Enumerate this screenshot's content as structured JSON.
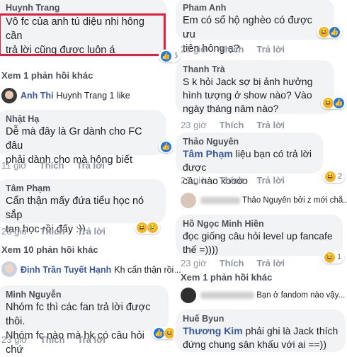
{
  "left": [
    {
      "name": "Huynh Trang",
      "lines": [
        "Vô fc của anh tú diệu nhi hông cần",
        "trả lời cũng được luôn á"
      ]
    },
    {
      "replies": "Xem 1 phản hồi khác"
    },
    {
      "sub_name": "Anh Thi",
      "sub_text": "Huynh Trang 1 like"
    },
    {
      "name": "Nhật Hạ",
      "lines": [
        "Dễ mà đây là Gr dành cho FC đâu",
        "phải dành cho mà hông biết"
      ],
      "time": "11 giờ",
      "like": "Thích",
      "reply": "Trả lời"
    },
    {
      "name": "Tâm Phạm",
      "lines": [
        "Cẩn thận mấy đứa tiểu học nó sắp",
        "tan học rồi đấy :))"
      ],
      "time": "23 giờ",
      "like": "Thích",
      "reply": "Trả lời"
    },
    {
      "replies": "Xem 10 phản hồi khác"
    },
    {
      "sub_name": "Đinh Trần Tuyết Hạnh",
      "sub_text": "Kh cẩn thận rồi..."
    },
    {
      "name": "Minh Nguyễn",
      "lines": [
        "Nhóm fc thì các fan trả lời được thôi.",
        "Nhóm fc nào mà hk có câu hỏi chứ"
      ],
      "time": "23 giờ",
      "like": "Thích",
      "reply": "Trả lời"
    }
  ],
  "right": [
    {
      "name": "Pham Anh",
      "lines": [
        "Em có sổ hộ nghèo có được ưu",
        "tiên hông ạ?"
      ],
      "time": "23 giờ",
      "like": "Thích",
      "reply": "Trả lời"
    },
    {
      "name": "Thanh Trà",
      "lines": [
        "S k hỏi Jack sợ bị ảnh hưởng",
        "hình tượng ở show nào?  Vào",
        "ngày tháng năm nào?"
      ],
      "time": "23 giờ",
      "like": "Thích",
      "reply": "Trả lời"
    },
    {
      "name": "Thảo Nguyên",
      "tag": "Tâm Phạm",
      "lines": [
        "liệu bạn có trả lời được",
        "câu nào koooo"
      ],
      "time": "23 giờ",
      "like": "Thích",
      "reply": "Trả lời"
    },
    {
      "sub_text": "Thảo Nguyên bởi z mới chắ..."
    },
    {
      "name": "Hồ Ngọc Minh Hiền",
      "lines": [
        "đọc giống câu hỏi level up fancafe",
        "thế =))))"
      ],
      "time": "23 giờ",
      "like": "Thích",
      "reply": "Trả lời"
    },
    {
      "replies": "Xem 1 phản hồi khác"
    },
    {
      "sub_text": "Bạn ở fandom nào vậy..."
    },
    {
      "name": "Huế Byun",
      "tag": "Thương Kim",
      "lines": [
        "phải ghi là Jack thích",
        "đứng chung sân khấu với ai ==))"
      ]
    }
  ],
  "counts": {
    "c5": "5",
    "c2": "2",
    "c1": "1"
  },
  "colors": {
    "highlight": "#e41e3f",
    "name": "#385898",
    "bubble": "#f2f3f5"
  }
}
